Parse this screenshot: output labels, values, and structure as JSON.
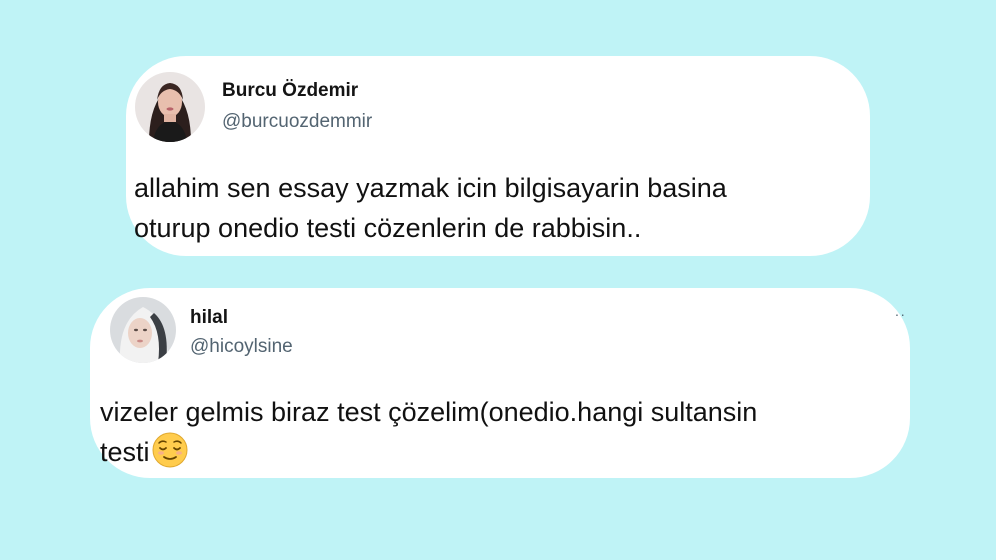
{
  "tweets": [
    {
      "name": "Burcu Özdemir",
      "handle": "@burcuozdemmir",
      "avatar_icon": "profile-photo-woman-dark-hair",
      "text_lines": [
        "allahim sen essay yazmak icin bilgisayarin basina",
        "oturup onedio testi cözenlerin de rabbisin.."
      ]
    },
    {
      "name": "hilal",
      "handle": "@hicoylsine",
      "avatar_icon": "profile-photo-woman-hijab",
      "text_lines": [
        "vizeler gelmis biraz test çözelim(onedio.hangi sultansin",
        "testi"
      ],
      "emoji": "relieved-face-emoji",
      "menu_icon": "more-dots-icon"
    }
  ],
  "colors": {
    "background": "#bff3f6",
    "card": "#ffffff",
    "name": "#141414",
    "handle": "#536471",
    "text": "#111111"
  }
}
